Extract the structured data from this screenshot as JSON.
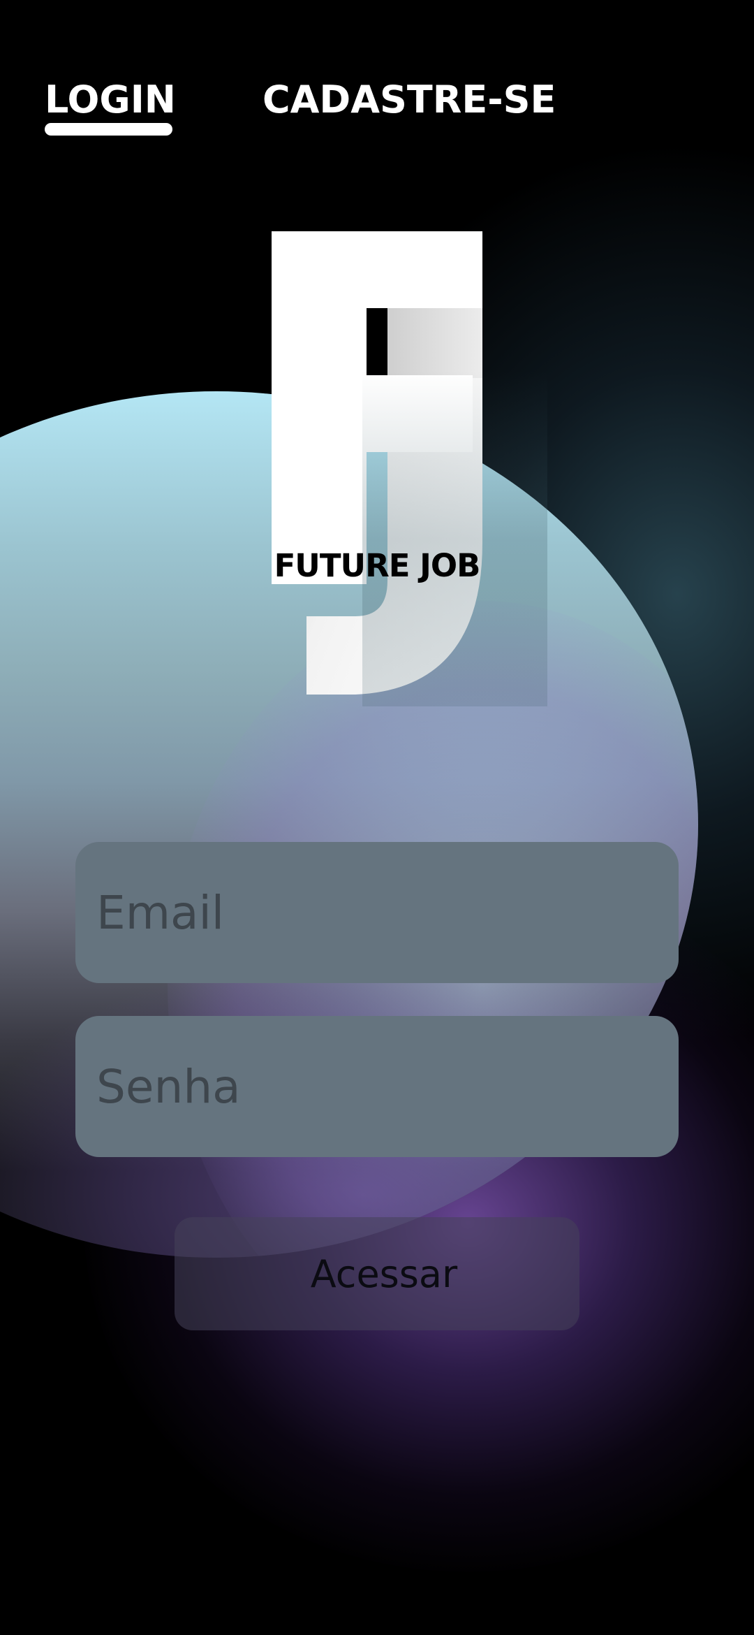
{
  "tabs": [
    {
      "label": "LOGIN",
      "active": true
    },
    {
      "label": "CADASTRE-SE",
      "active": false
    }
  ],
  "logo": {
    "monogram": "FJ",
    "brand": "FUTURE JOB"
  },
  "form": {
    "email_placeholder": "Email",
    "email_value": "",
    "password_placeholder": "Senha",
    "password_value": "",
    "submit_label": "Acessar"
  },
  "colors": {
    "background": "#000000",
    "field_fill": "#65747f",
    "field_text": "#3e464d",
    "orb_top": "#b4e6f4",
    "glow_purple": "#7850aa",
    "tab_text": "#ffffff"
  }
}
